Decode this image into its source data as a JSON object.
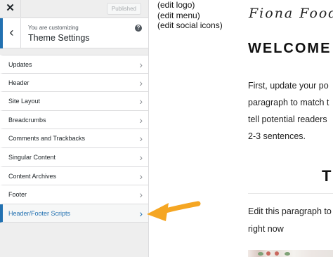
{
  "topbar": {
    "close_icon": "close-icon",
    "published_label": "Published"
  },
  "panel_header": {
    "back_icon": "chevron-left-icon",
    "customizing_label": "You are customizing",
    "title": "Theme Settings",
    "help_icon": "help-icon"
  },
  "sections": [
    {
      "label": "Updates"
    },
    {
      "label": "Header"
    },
    {
      "label": "Site Layout"
    },
    {
      "label": "Breadcrumbs"
    },
    {
      "label": "Comments and Trackbacks"
    },
    {
      "label": "Singular Content"
    },
    {
      "label": "Content Archives"
    },
    {
      "label": "Footer"
    },
    {
      "label": "Header/Footer Scripts"
    }
  ],
  "preview": {
    "edit_logo": "(edit logo)",
    "edit_menu": "(edit menu)",
    "edit_social": "(edit social icons)",
    "site_title": "Fiona Foodie",
    "welcome_heading": "WELCOME",
    "paragraph_lines": [
      "First, update your po",
      "paragraph to match t",
      "tell potential readers",
      "2-3 sentences."
    ],
    "section_heading": "T",
    "paragraph2_lines": [
      "Edit this paragraph to",
      "right now"
    ]
  },
  "annotation": {
    "arrow_color": "#f5a623",
    "points_to": "Header/Footer Scripts"
  },
  "colors": {
    "accent": "#2271b1",
    "sidebar_bg": "#eeeeee"
  }
}
